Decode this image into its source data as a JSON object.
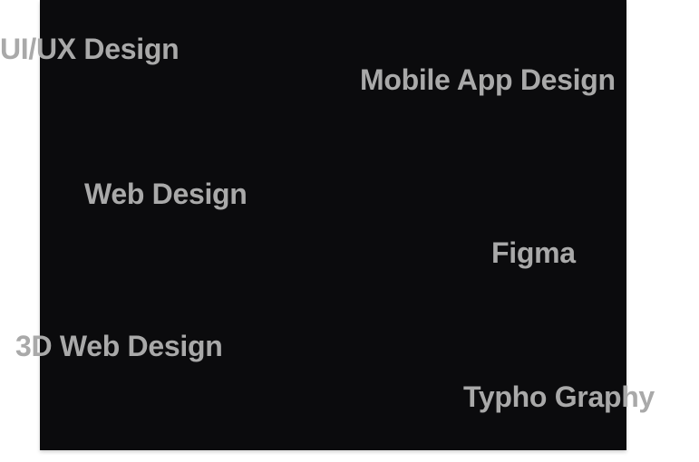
{
  "panel": {
    "background": "#0b0b0d",
    "tag_color": "#a9a9a9"
  },
  "tags": [
    {
      "label": "UI/UX Design"
    },
    {
      "label": "Mobile App Design"
    },
    {
      "label": "Web Design"
    },
    {
      "label": "Figma"
    },
    {
      "label": "3D Web Design"
    },
    {
      "label": "Typho Graphy"
    }
  ]
}
